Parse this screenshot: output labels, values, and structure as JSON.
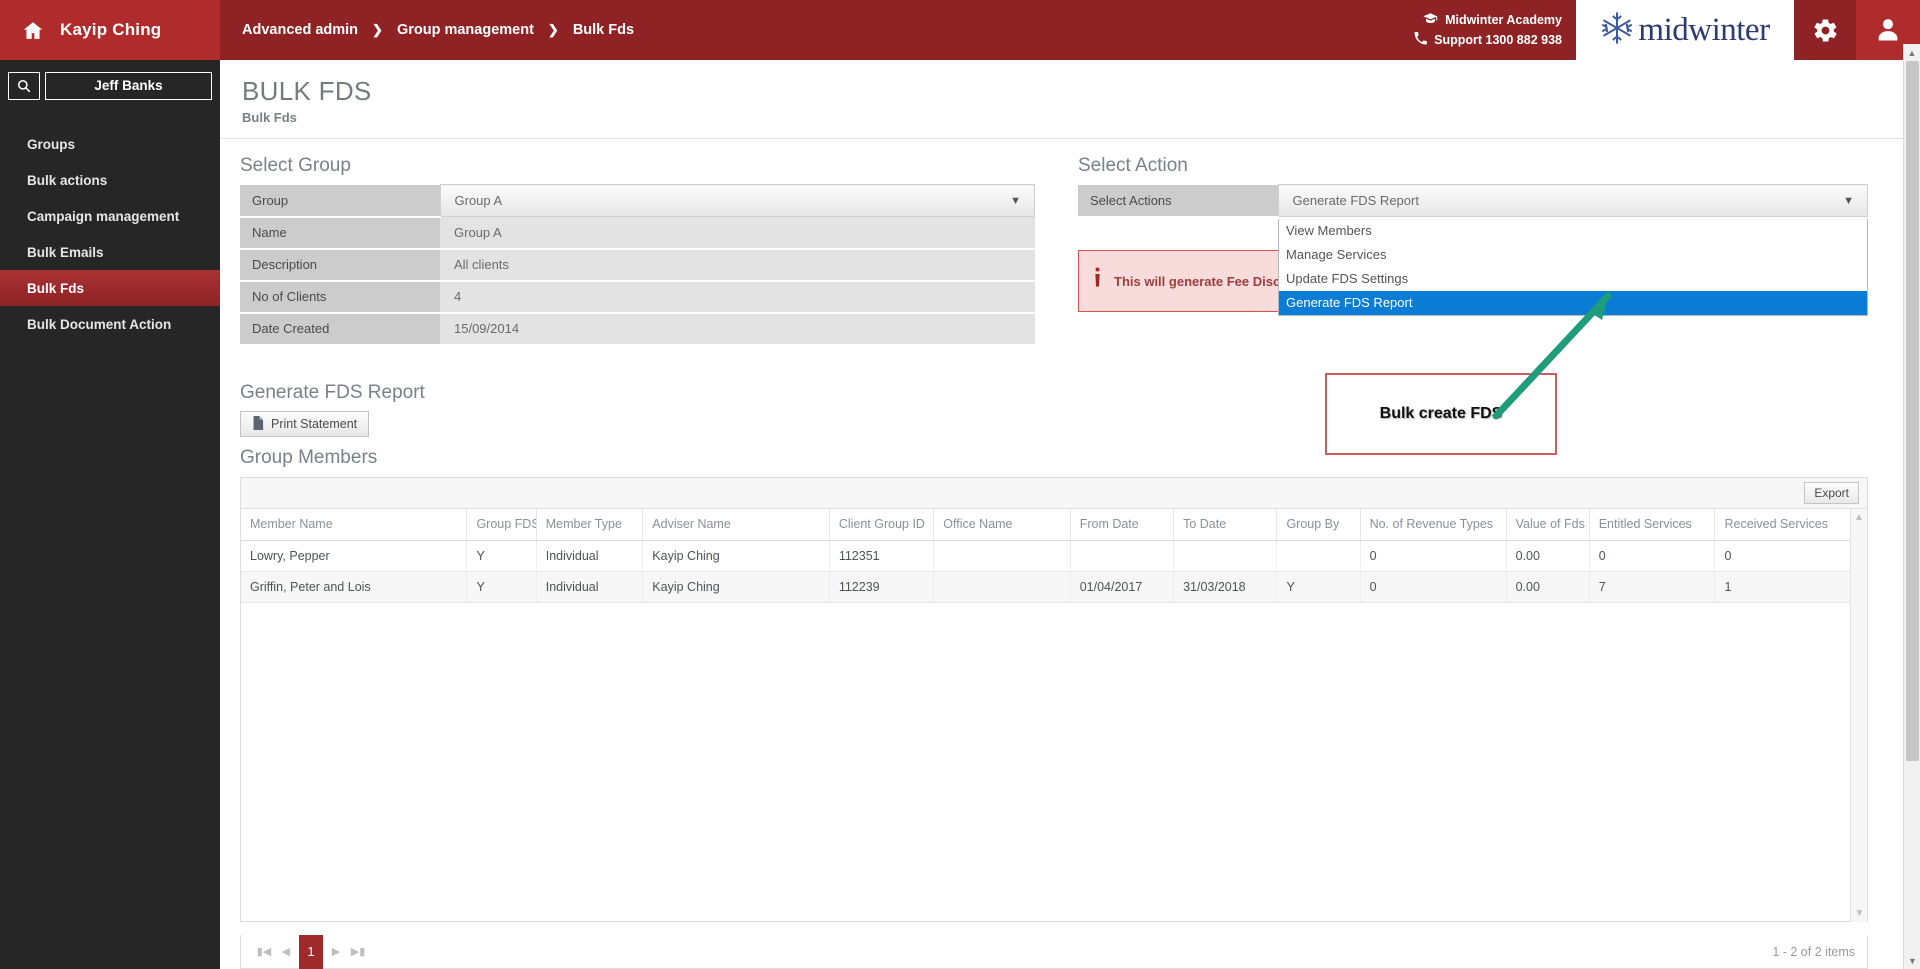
{
  "header": {
    "brand_name": "Kayip Ching",
    "home_icon": "home-icon",
    "breadcrumbs": [
      "Advanced admin",
      "Group management",
      "Bulk Fds"
    ],
    "breadcrumb_separator": "❯",
    "academy_label": "Midwinter Academy",
    "academy_icon": "graduation-cap-icon",
    "support_label": "Support 1300 882 938",
    "support_icon": "phone-icon",
    "logo_text": "midwinter",
    "logo_icon": "snowflake-icon",
    "gear_icon": "gear-icon",
    "user_icon": "user-avatar-icon"
  },
  "sidebar": {
    "search_icon": "search-icon",
    "search_value": "Jeff Banks",
    "search_placeholder": "Search",
    "items": [
      {
        "label": "Groups",
        "active": false
      },
      {
        "label": "Bulk actions",
        "active": false
      },
      {
        "label": "Campaign management",
        "active": false
      },
      {
        "label": "Bulk Emails",
        "active": false
      },
      {
        "label": "Bulk Fds",
        "active": true
      },
      {
        "label": "Bulk Document Action",
        "active": false
      }
    ]
  },
  "page": {
    "title": "BULK FDS",
    "subtitle": "Bulk Fds"
  },
  "select_group": {
    "heading": "Select Group",
    "rows": [
      {
        "key": "Group",
        "value": "Group A",
        "dropdown": true
      },
      {
        "key": "Name",
        "value": "Group A",
        "dropdown": false
      },
      {
        "key": "Description",
        "value": "All clients",
        "dropdown": false
      },
      {
        "key": "No of Clients",
        "value": "4",
        "dropdown": false
      },
      {
        "key": "Date Created",
        "value": "15/09/2014",
        "dropdown": false
      }
    ]
  },
  "select_action": {
    "heading": "Select Action",
    "label": "Select Actions",
    "value": "Generate FDS Report",
    "caret_icon": "chevron-down-icon",
    "options": [
      {
        "label": "View Members",
        "selected": false
      },
      {
        "label": "Manage Services",
        "selected": false
      },
      {
        "label": "Update FDS Settings",
        "selected": false
      },
      {
        "label": "Generate FDS Report",
        "selected": true
      }
    ],
    "alert_icon": "info-icon",
    "alert_text": "This will generate Fee Disclosure Statements"
  },
  "generate_fds": {
    "heading": "Generate FDS Report",
    "print_button": "Print Statement",
    "print_icon": "document-icon"
  },
  "group_members": {
    "heading": "Group Members",
    "export_button": "Export",
    "columns": [
      "Member Name",
      "Group FDS",
      "Member Type",
      "Adviser Name",
      "Client Group ID",
      "Office Name",
      "From Date",
      "To Date",
      "Group By",
      "No. of Revenue Types",
      "Value of Fds",
      "Entitled Services",
      "Received Services"
    ],
    "rows": [
      [
        "Lowry, Pepper",
        "Y",
        "Individual",
        "Kayip Ching",
        "112351",
        "",
        "",
        "",
        "",
        "0",
        "0.00",
        "0",
        "0"
      ],
      [
        "Griffin, Peter and Lois",
        "Y",
        "Individual",
        "Kayip Ching",
        "112239",
        "",
        "01/04/2017",
        "31/03/2018",
        "Y",
        "0",
        "0.00",
        "7",
        "1"
      ]
    ]
  },
  "pager": {
    "first_icon": "first-page-icon",
    "prev_icon": "prev-page-icon",
    "next_icon": "next-page-icon",
    "last_icon": "last-page-icon",
    "current_page": "1",
    "count_text": "1 - 2 of 2 items"
  },
  "annotation": {
    "text": "Bulk create FDS",
    "box_color": "#cf5c5c",
    "arrow_color": "#1f9d7a"
  }
}
